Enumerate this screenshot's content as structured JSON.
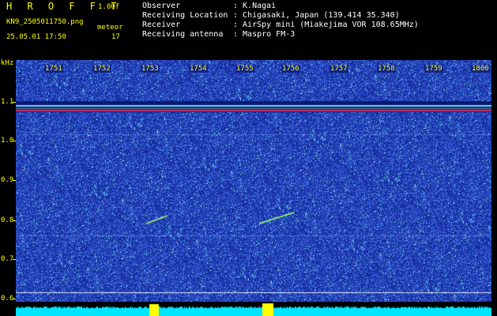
{
  "header": {
    "title": "H R O F F T",
    "version": "1.00f",
    "filename": "KN9_2505011750.png",
    "mode": "meteor",
    "datetime": "25.05.01 17:50",
    "count": "17",
    "meta": [
      {
        "label": "Observer",
        "value": ": K.Nagai"
      },
      {
        "label": "Receiving Location",
        "value": ": Chigasaki, Japan (139.414 35.340)"
      },
      {
        "label": "Receiver",
        "value": ": AirSpy mini (Miakejima VOR 108.65MHz)"
      },
      {
        "label": "Receiving antenna",
        "value": ": Maspro FM-3"
      }
    ]
  },
  "axes": {
    "y_unit": "kHz",
    "y_ticks": [
      "1.1",
      "1.0",
      "0.9",
      "0.8",
      "0.7",
      "0.6"
    ],
    "x_ticks": [
      "1751",
      "1752",
      "1753",
      "1754",
      "1755",
      "1756",
      "1757",
      "1758",
      "1759",
      "1800"
    ]
  },
  "colors": {
    "background": "#152a9a",
    "label": "#ffff00",
    "carrier": "#ff3366",
    "meteor": "#9dff6a",
    "baseline": "#00e5ff"
  }
}
